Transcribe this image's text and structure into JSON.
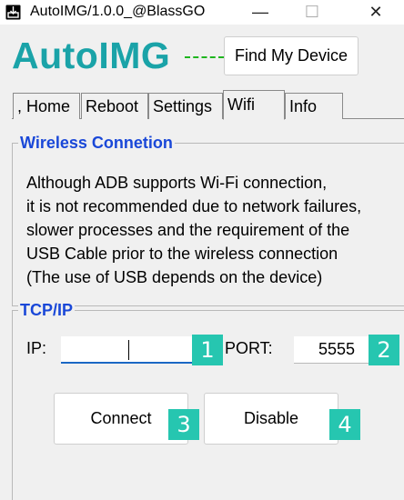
{
  "window": {
    "title": "AutoIMG/1.0.0_@BlassGO",
    "minimize_glyph": "—",
    "maximize_glyph": "☐",
    "close_glyph": "✕"
  },
  "header": {
    "logo_text": "AutoIMG",
    "find_device_label": "Find My Device"
  },
  "tabs": [
    {
      "label": ", Home",
      "active": false
    },
    {
      "label": "Reboot",
      "active": false
    },
    {
      "label": "Settings",
      "active": false
    },
    {
      "label": "Wifi",
      "active": true
    },
    {
      "label": "Info",
      "active": false
    }
  ],
  "wireless": {
    "title": "Wireless Connetion",
    "description_lines": [
      "Although ADB supports Wi-Fi connection,",
      "it is not recommended due to network failures,",
      "slower processes and the requirement of the",
      "USB Cable prior to the wireless connection",
      "(The use of USB depends on the device)"
    ]
  },
  "tcp": {
    "title": "TCP/IP",
    "ip_label": "IP:",
    "ip_value": "",
    "port_label": "PORT:",
    "port_value": "5555",
    "connect_label": "Connect",
    "disable_label": "Disable"
  },
  "badges": [
    "1",
    "2",
    "3",
    "4"
  ],
  "colors": {
    "logo": "#1aa3a8",
    "group_title": "#1a48d8",
    "badge": "#26c6b0",
    "input_focus": "#1a67c4",
    "dash_line": "#1eb51e"
  },
  "icons": {
    "app": "download-box-icon"
  }
}
